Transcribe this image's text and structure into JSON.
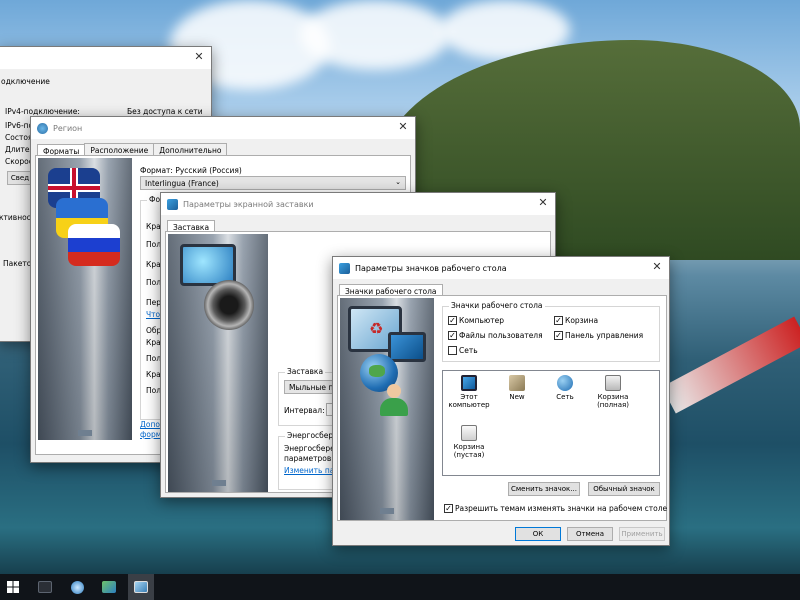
{
  "network_window": {
    "title_partial": "одключение",
    "rows": [
      {
        "label": "IPv4-подключение:",
        "value": "Без доступа к сети"
      },
      {
        "label": "IPv6-под",
        "value": ""
      },
      {
        "label": "Состоя",
        "value": ""
      },
      {
        "label": "Длител",
        "value": ""
      },
      {
        "label": "Скорос",
        "value": ""
      }
    ],
    "details_button": "Свед",
    "activity_label": "ктивность",
    "packets_label": "Пакетов"
  },
  "region_window": {
    "title": "Регион",
    "tabs": [
      "Форматы",
      "Расположение",
      "Дополнительно"
    ],
    "format_label": "Формат: Русский (Россия)",
    "format_value": "Interlingua (France)",
    "group_label": "Фор",
    "short_labels": [
      "Крат",
      "Пол",
      "Крат",
      "Пол",
      "Перв"
    ],
    "link_what": "Что",
    "examples_label": "Обр",
    "example_labels": [
      "Крат",
      "Пол",
      "Крат",
      "Пол"
    ],
    "bottom_links": [
      "Допо",
      "форм"
    ]
  },
  "screensaver_window": {
    "title": "Параметры экранной заставки",
    "tab": "Заставка",
    "screensaver_group": "Заставка",
    "screensaver_value": "Мыльные пуз",
    "interval_label": "Интервал:",
    "energy_group": "Энергосбереж",
    "energy_text_1": "Энергосбереж",
    "energy_text_2": "параметров э",
    "energy_link": "Изменить пара"
  },
  "desktop_icons_window": {
    "title": "Параметры значков рабочего стола",
    "tab": "Значки рабочего стола",
    "group_label": "Значки рабочего стола",
    "checkboxes": [
      {
        "label": "Компьютер",
        "checked": true
      },
      {
        "label": "Корзина",
        "checked": true
      },
      {
        "label": "Файлы пользователя",
        "checked": true
      },
      {
        "label": "Панель управления",
        "checked": true
      },
      {
        "label": "Сеть",
        "checked": false
      }
    ],
    "icons": [
      {
        "label": "Этот компьютер",
        "icon": "computer-icon"
      },
      {
        "label": "New",
        "icon": "user-folder-icon"
      },
      {
        "label": "Сеть",
        "icon": "network-icon"
      },
      {
        "label": "Корзина (полная)",
        "icon": "recycle-bin-full-icon"
      },
      {
        "label": "Корзина (пустая)",
        "icon": "recycle-bin-empty-icon"
      }
    ],
    "change_icon_button": "Сменить значок...",
    "default_icon_button": "Обычный значок",
    "allow_themes_label": "Разрешить темам изменять значки на рабочем столе",
    "allow_themes_checked": true,
    "ok_button": "ОК",
    "cancel_button": "Отмена",
    "apply_button": "Применить"
  },
  "taskbar": {
    "items": [
      "windows-start-icon",
      "network-app-icon",
      "circle-app-icon",
      "control-panel-icon",
      "desktop-settings-icon"
    ]
  }
}
